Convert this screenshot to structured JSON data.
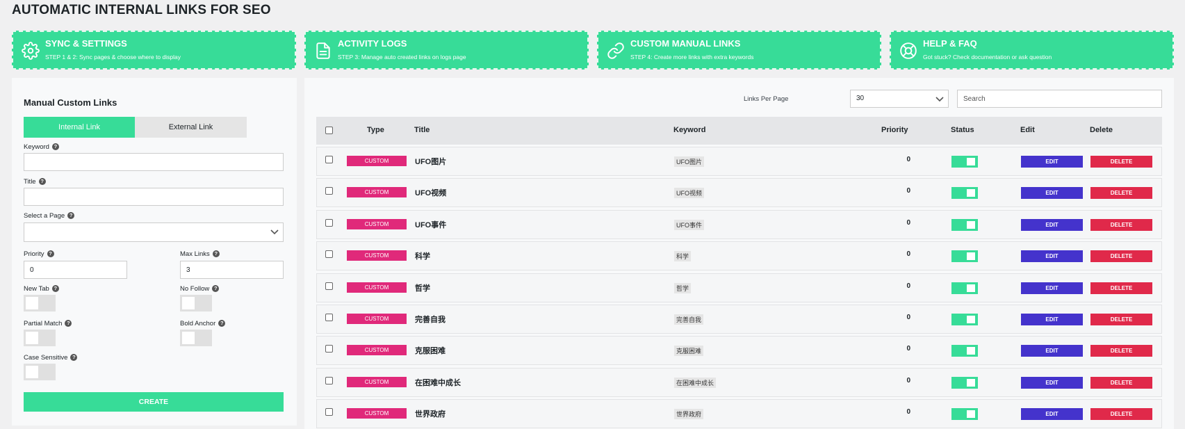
{
  "page_title": "AUTOMATIC INTERNAL LINKS FOR SEO",
  "colors": {
    "accent": "#37dc98",
    "badge": "#e0297a",
    "edit": "#4433cc",
    "delete": "#e0294a"
  },
  "cards": [
    {
      "icon": "gear-icon",
      "title": "SYNC & SETTINGS",
      "subtitle": "STEP 1 & 2: Sync pages & choose where to display"
    },
    {
      "icon": "document-icon",
      "title": "ACTIVITY LOGS",
      "subtitle": "STEP 3: Manage auto created links on logs page"
    },
    {
      "icon": "link-icon",
      "title": "CUSTOM MANUAL LINKS",
      "subtitle": "STEP 4: Create more links with extra keywords"
    },
    {
      "icon": "lifebuoy-icon",
      "title": "HELP & FAQ",
      "subtitle": "Got stuck? Check documentation or ask question"
    }
  ],
  "form": {
    "title": "Manual Custom Links",
    "tabs": {
      "internal": "Internal Link",
      "external": "External Link"
    },
    "keyword_label": "Keyword",
    "keyword_value": "",
    "title_label": "Title",
    "title_value": "",
    "select_page_label": "Select a Page",
    "select_page_value": "",
    "priority_label": "Priority",
    "priority_value": "0",
    "max_links_label": "Max Links",
    "max_links_value": "3",
    "new_tab_label": "New Tab",
    "no_follow_label": "No Follow",
    "partial_match_label": "Partial Match",
    "bold_anchor_label": "Bold Anchor",
    "case_sensitive_label": "Case Sensitive",
    "toggles": {
      "new_tab": false,
      "no_follow": false,
      "partial_match": false,
      "bold_anchor": false,
      "case_sensitive": false
    },
    "create_label": "CREATE"
  },
  "table_controls": {
    "links_per_page_label": "Links Per Page",
    "links_per_page_value": "30",
    "search_placeholder": "Search"
  },
  "table": {
    "headers": {
      "type": "Type",
      "title": "Title",
      "keyword": "Keyword",
      "priority": "Priority",
      "status": "Status",
      "edit": "Edit",
      "delete": "Delete"
    },
    "rows": [
      {
        "type": "CUSTOM",
        "title": "UFO图片",
        "keyword": "UFO图片",
        "priority": "0",
        "status": true,
        "edit": "EDIT",
        "delete": "DELETE"
      },
      {
        "type": "CUSTOM",
        "title": "UFO视频",
        "keyword": "UFO视频",
        "priority": "0",
        "status": true,
        "edit": "EDIT",
        "delete": "DELETE"
      },
      {
        "type": "CUSTOM",
        "title": "UFO事件",
        "keyword": "UFO事件",
        "priority": "0",
        "status": true,
        "edit": "EDIT",
        "delete": "DELETE"
      },
      {
        "type": "CUSTOM",
        "title": "科学",
        "keyword": "科学",
        "priority": "0",
        "status": true,
        "edit": "EDIT",
        "delete": "DELETE"
      },
      {
        "type": "CUSTOM",
        "title": "哲学",
        "keyword": "哲学",
        "priority": "0",
        "status": true,
        "edit": "EDIT",
        "delete": "DELETE"
      },
      {
        "type": "CUSTOM",
        "title": "完善自我",
        "keyword": "完善自我",
        "priority": "0",
        "status": true,
        "edit": "EDIT",
        "delete": "DELETE"
      },
      {
        "type": "CUSTOM",
        "title": "克服困难",
        "keyword": "克服困难",
        "priority": "0",
        "status": true,
        "edit": "EDIT",
        "delete": "DELETE"
      },
      {
        "type": "CUSTOM",
        "title": "在困难中成长",
        "keyword": "在困难中成长",
        "priority": "0",
        "status": true,
        "edit": "EDIT",
        "delete": "DELETE"
      },
      {
        "type": "CUSTOM",
        "title": "世界政府",
        "keyword": "世界政府",
        "priority": "0",
        "status": true,
        "edit": "EDIT",
        "delete": "DELETE"
      }
    ]
  }
}
